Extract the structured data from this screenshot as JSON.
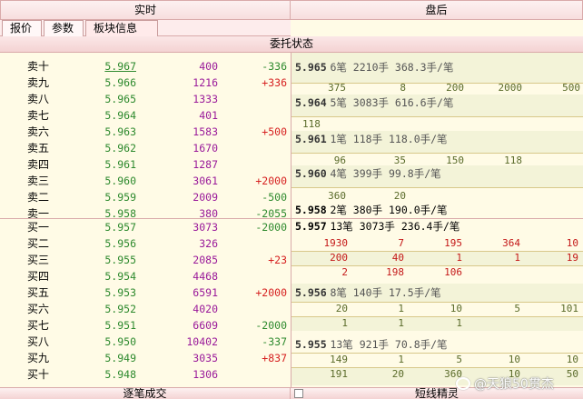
{
  "top_tabs": {
    "realtime": "实时",
    "after_hours": "盘后"
  },
  "sub_tabs": [
    "报价",
    "参数",
    "板块信息"
  ],
  "section_title": "委托状态",
  "sell_rows": [
    {
      "label": "卖十",
      "price": "5.967",
      "volume": "400",
      "change": "-336",
      "dir": "dn"
    },
    {
      "label": "卖九",
      "price": "5.966",
      "volume": "1216",
      "change": "+336",
      "dir": "up"
    },
    {
      "label": "卖八",
      "price": "5.965",
      "volume": "1333",
      "change": "",
      "dir": ""
    },
    {
      "label": "卖七",
      "price": "5.964",
      "volume": "401",
      "change": "",
      "dir": ""
    },
    {
      "label": "卖六",
      "price": "5.963",
      "volume": "1583",
      "change": "+500",
      "dir": "up"
    },
    {
      "label": "卖五",
      "price": "5.962",
      "volume": "1670",
      "change": "",
      "dir": ""
    },
    {
      "label": "卖四",
      "price": "5.961",
      "volume": "1287",
      "change": "",
      "dir": ""
    },
    {
      "label": "卖三",
      "price": "5.960",
      "volume": "3061",
      "change": "+2000",
      "dir": "up"
    },
    {
      "label": "卖二",
      "price": "5.959",
      "volume": "2009",
      "change": "-500",
      "dir": "dn"
    },
    {
      "label": "卖一",
      "price": "5.958",
      "volume": "380",
      "change": "-2055",
      "dir": "dn"
    }
  ],
  "buy_rows": [
    {
      "label": "买一",
      "price": "5.957",
      "volume": "3073",
      "change": "-2000",
      "dir": "dn"
    },
    {
      "label": "买二",
      "price": "5.956",
      "volume": "326",
      "change": "",
      "dir": ""
    },
    {
      "label": "买三",
      "price": "5.955",
      "volume": "2085",
      "change": "+23",
      "dir": "up"
    },
    {
      "label": "买四",
      "price": "5.954",
      "volume": "4468",
      "change": "",
      "dir": ""
    },
    {
      "label": "买五",
      "price": "5.953",
      "volume": "6591",
      "change": "+2000",
      "dir": "up"
    },
    {
      "label": "买六",
      "price": "5.952",
      "volume": "4020",
      "change": "",
      "dir": ""
    },
    {
      "label": "买七",
      "price": "5.951",
      "volume": "6609",
      "change": "-2000",
      "dir": "dn"
    },
    {
      "label": "买八",
      "price": "5.950",
      "volume": "10402",
      "change": "-337",
      "dir": "dn"
    },
    {
      "label": "买九",
      "price": "5.949",
      "volume": "3035",
      "change": "+837",
      "dir": "up"
    },
    {
      "label": "买十",
      "price": "5.948",
      "volume": "1306",
      "change": "",
      "dir": ""
    }
  ],
  "queue": {
    "q1": {
      "price": "5.965",
      "rest": "6笔 2210手 368.3手/笔",
      "nums": [
        "375",
        "8",
        "200",
        "2000",
        "500"
      ]
    },
    "q2": {
      "price": "5.964",
      "rest": "5笔 3083手 616.6手/笔",
      "nums": [
        "118"
      ]
    },
    "q3": {
      "price": "5.961",
      "rest": "1笔 118手 118.0手/笔",
      "nums": [
        "96",
        "35",
        "150",
        "118"
      ]
    },
    "q4": {
      "price": "5.960",
      "rest": "4笔 399手 99.8手/笔",
      "nums": [
        "360",
        "20"
      ]
    },
    "q5": {
      "price": "5.958",
      "rest": "2笔 380手 190.0手/笔"
    },
    "q6": {
      "price": "5.957",
      "rest": "13笔 3073手 236.4手/笔",
      "nums1": [
        "1930",
        "7",
        "195",
        "364",
        "10"
      ],
      "nums2": [
        "200",
        "40",
        "1",
        "1",
        "19"
      ],
      "nums3": [
        "2",
        "198",
        "106"
      ]
    },
    "q7": {
      "price": "5.956",
      "rest": "8笔 140手 17.5手/笔",
      "nums1": [
        "20",
        "1",
        "10",
        "5",
        "101"
      ],
      "nums2": [
        "1",
        "1",
        "1"
      ]
    },
    "q8": {
      "price": "5.955",
      "rest": "13笔 921手 70.8手/笔",
      "nums1": [
        "149",
        "1",
        "5",
        "10",
        "10"
      ],
      "nums2": [
        "191",
        "20",
        "360",
        "10",
        "50"
      ]
    }
  },
  "bottom_tabs": {
    "left": "逐笔成交",
    "right": "短线精灵"
  },
  "watermark": "@天狼50贯杰"
}
